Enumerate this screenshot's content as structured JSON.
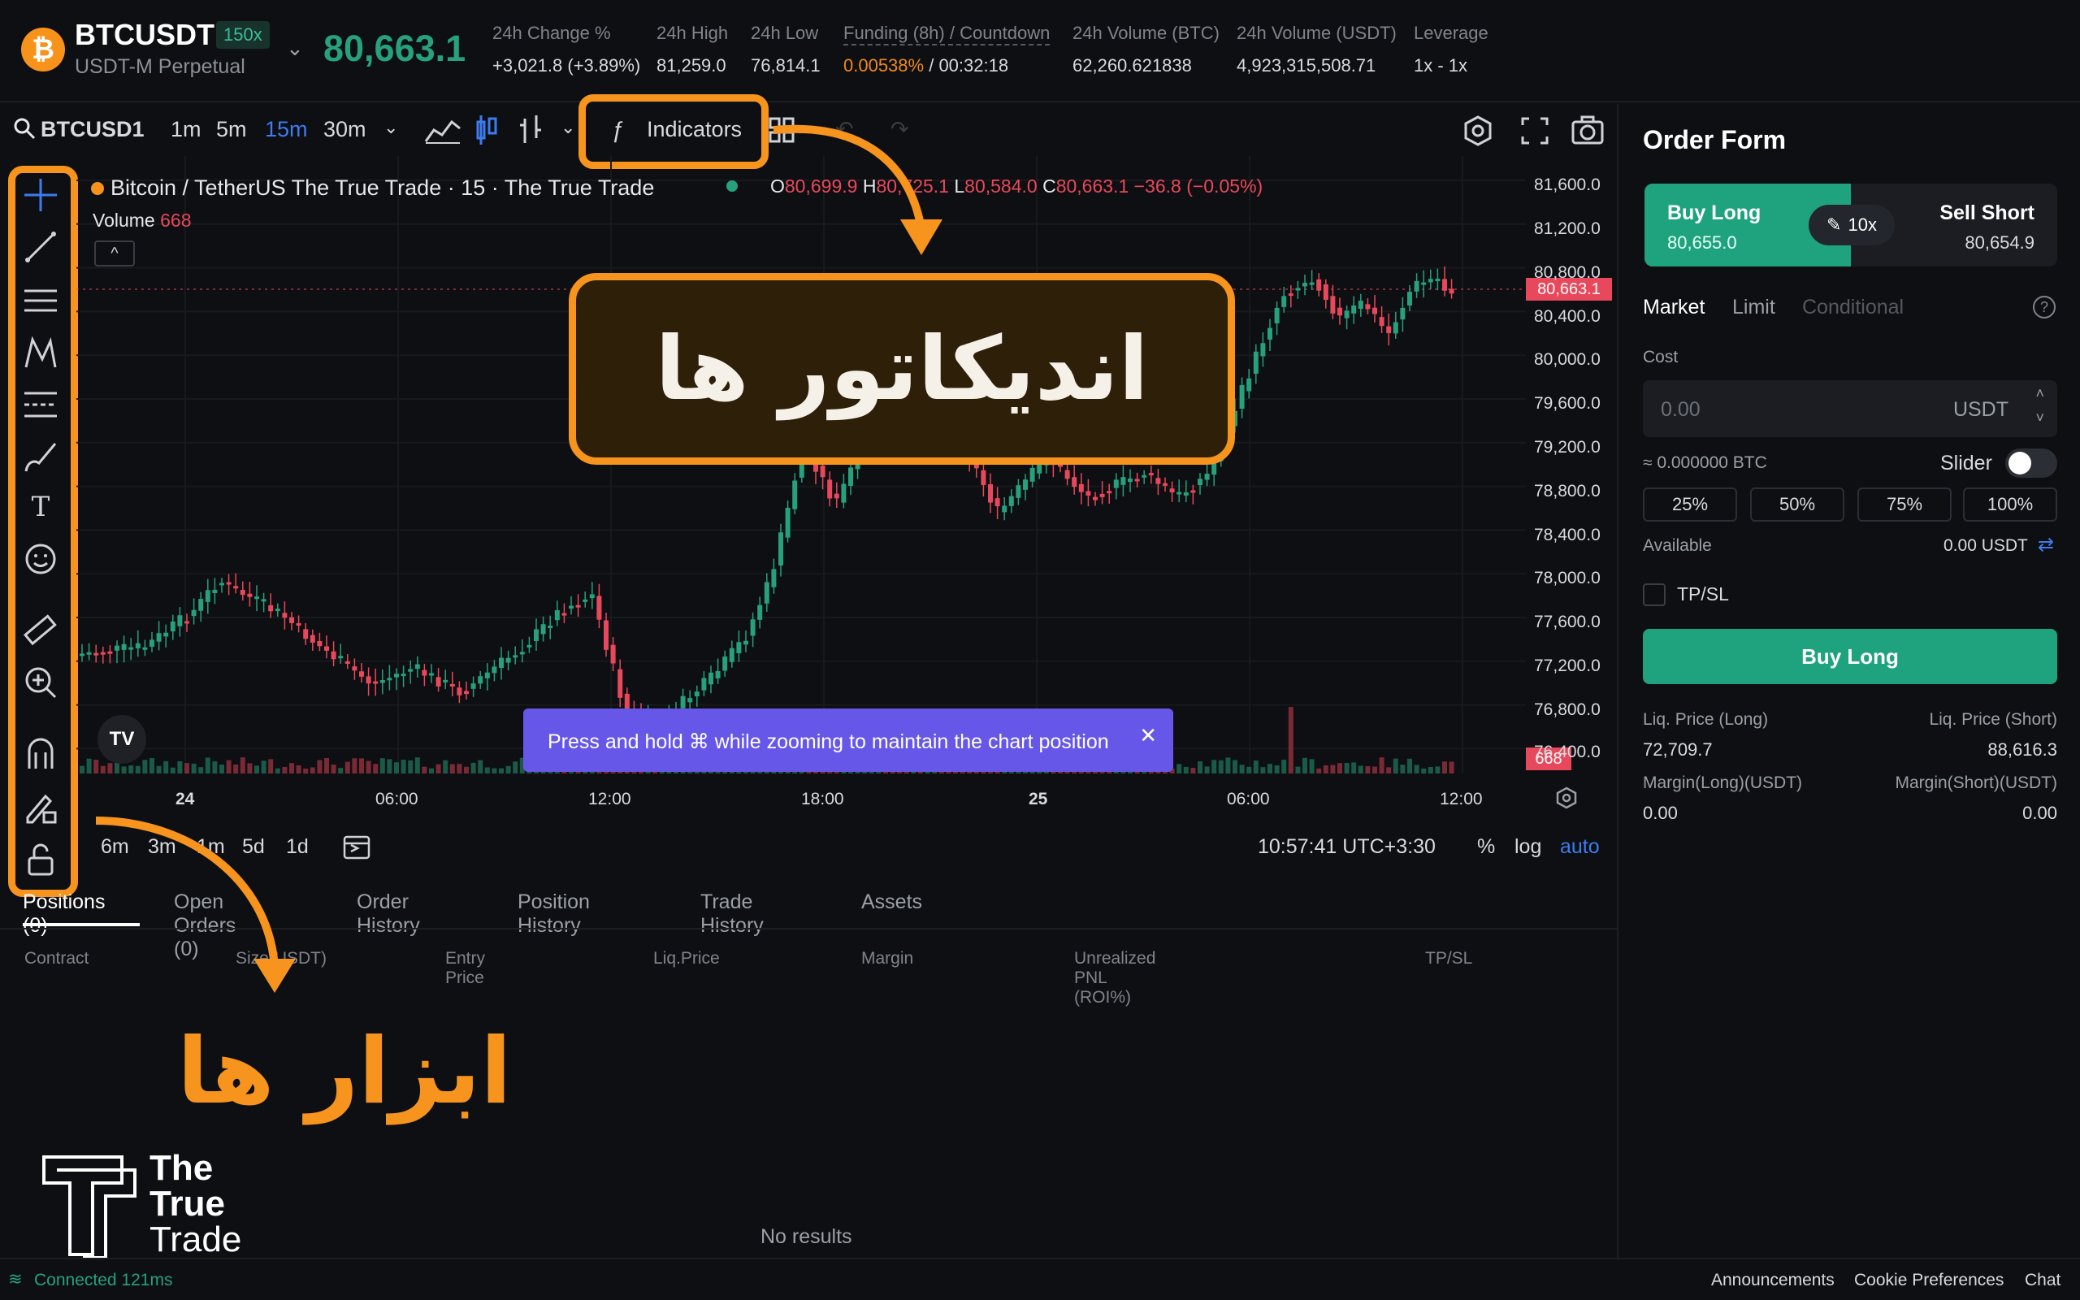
{
  "header": {
    "symbol": "BTCUSDT",
    "leverage_badge": "150x",
    "contract_type": "USDT-M Perpetual",
    "coin_glyph": "₿",
    "last_price": "80,663.1",
    "stats": [
      {
        "label": "24h Change %",
        "value": "+3,021.8 (+3.89%)"
      },
      {
        "label": "24h High",
        "value": "81,259.0"
      },
      {
        "label": "24h Low",
        "value": "76,814.1"
      },
      {
        "label": "Funding (8h) / Countdown",
        "value_rate": "0.00538%",
        "value_sep": " / ",
        "value_countdown": "00:32:18"
      },
      {
        "label": "24h Volume (BTC)",
        "value": "62,260.621838"
      },
      {
        "label": "24h Volume (USDT)",
        "value": "4,923,315,508.71"
      },
      {
        "label": "Leverage",
        "value": "1x - 1x"
      }
    ]
  },
  "chart_toolbar": {
    "search_symbol": "BTCUSD1",
    "intervals": [
      "1m",
      "5m",
      "15m",
      "30m"
    ],
    "active_interval": "15m",
    "indicators_label": "Indicators"
  },
  "chart": {
    "title": "Bitcoin / TetherUS The True Trade · 15 · The True Trade",
    "ohlc": {
      "o_label": "O",
      "o": "80,699.9",
      "h_label": "H",
      "h": "80,725.1",
      "l_label": "L",
      "l": "80,584.0",
      "c_label": "C",
      "c": "80,663.1",
      "change": "−36.8 (−0.05%)"
    },
    "volume_label": "Volume",
    "volume_value": "668",
    "current_price_tag": "80,663.1",
    "volume_tag": "668",
    "price_labels": [
      "81,600.0",
      "81,200.0",
      "80,800.0",
      "80,400.0",
      "80,000.0",
      "79,600.0",
      "79,200.0",
      "78,800.0",
      "78,400.0",
      "78,000.0",
      "77,600.0",
      "77,200.0",
      "76,800.0",
      "76,400.0"
    ],
    "time_labels": [
      "24",
      "06:00",
      "12:00",
      "18:00",
      "25",
      "06:00",
      "12:00"
    ],
    "toast": "Press and hold ⌘ while zooming to maintain the chart position",
    "ranges": [
      "6m",
      "3m",
      "1m",
      "5d",
      "1d"
    ],
    "clock": "10:57:41 UTC+3:30",
    "pct": "%",
    "log": "log",
    "auto": "auto",
    "tv_logo": "TV"
  },
  "overlays": {
    "indicators_caption": "اندیکاتور ها",
    "tools_caption": "ابزار ها",
    "brand_line1": "The",
    "brand_line2": "True",
    "brand_line3": "Trade"
  },
  "bottom": {
    "tabs": [
      "Positions (0)",
      "Open Orders (0)",
      "Order History",
      "Position History",
      "Trade History",
      "Assets"
    ],
    "columns": [
      "Contract",
      "Size(USDT)",
      "Entry Price",
      "Liq.Price",
      "Margin",
      "Unrealized PNL (ROI%)",
      "TP/SL"
    ],
    "empty": "No results"
  },
  "order_form": {
    "title": "Order Form",
    "buy_label": "Buy Long",
    "buy_price": "80,655.0",
    "sell_label": "Sell Short",
    "sell_price": "80,654.9",
    "lev": "10x",
    "order_types": [
      "Market",
      "Limit",
      "Conditional"
    ],
    "cost_label": "Cost",
    "cost_placeholder": "0.00",
    "cost_unit": "USDT",
    "approx": "≈ 0.000000 BTC",
    "slider_label": "Slider",
    "pcts": [
      "25%",
      "50%",
      "75%",
      "100%"
    ],
    "available_label": "Available",
    "available_value": "0.00 USDT",
    "tpsl": "TP/SL",
    "submit": "Buy Long",
    "liq_long_label": "Liq. Price (Long)",
    "liq_short_label": "Liq. Price (Short)",
    "liq_long": "72,709.7",
    "liq_short": "88,616.3",
    "margin_long_label": "Margin(Long)(USDT)",
    "margin_short_label": "Margin(Short)(USDT)",
    "margin_long": "0.00",
    "margin_short": "0.00"
  },
  "footer": {
    "status": "Connected 121ms",
    "links": [
      "Announcements",
      "Cookie Preferences",
      "Chat"
    ]
  },
  "colors": {
    "up": "#26a17b",
    "down": "#e8485b",
    "highlight": "#f7941d",
    "toast": "#6657e8"
  }
}
